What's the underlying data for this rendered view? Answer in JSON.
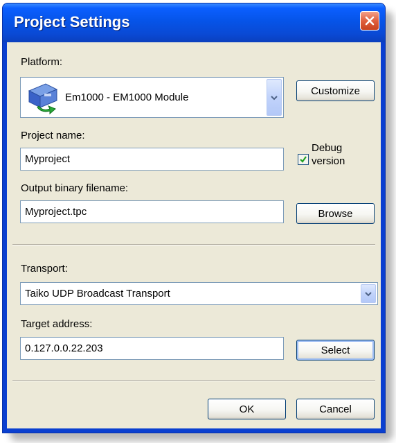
{
  "window": {
    "title": "Project Settings",
    "close_icon": "close-icon"
  },
  "platform": {
    "label": "Platform:",
    "selected": "Em1000 - EM1000 Module",
    "icon": "module-icon",
    "customize_label": "Customize"
  },
  "project_name": {
    "label": "Project name:",
    "value": "Myproject"
  },
  "debug": {
    "label_line1": "Debug",
    "label_line2": "version",
    "checked": true
  },
  "output": {
    "label": "Output binary filename:",
    "value": "Myproject.tpc",
    "browse_label": "Browse"
  },
  "transport": {
    "label": "Transport:",
    "selected": "Taiko UDP Broadcast Transport"
  },
  "target": {
    "label": "Target address:",
    "value": "0.127.0.0.22.203",
    "select_label": "Select"
  },
  "footer": {
    "ok_label": "OK",
    "cancel_label": "Cancel"
  },
  "colors": {
    "titlebar": "#0a49d4",
    "client_background": "#ece9d8",
    "close_button": "#e0603f",
    "checkmark": "#21a121"
  }
}
